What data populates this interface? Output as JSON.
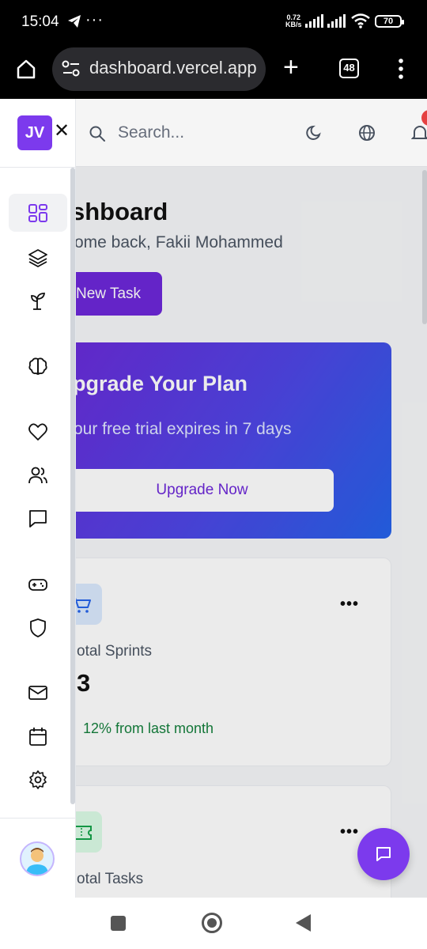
{
  "status_bar": {
    "time": "15:04",
    "net_speed_value": "0.72",
    "net_speed_unit": "KB/s",
    "battery": "70",
    "icons": [
      "telegram-icon",
      "more-dots-icon",
      "signal-icon",
      "signal-icon",
      "wifi-icon",
      "battery-icon"
    ]
  },
  "browser": {
    "url": "dashboard.vercel.app",
    "tab_count": "48"
  },
  "sidebar": {
    "logo": "JV",
    "items": [
      {
        "icon": "dashboard-grid-icon",
        "active": true
      },
      {
        "icon": "layers-icon",
        "active": false
      },
      {
        "icon": "sprout-icon",
        "active": false
      },
      {
        "icon": "brain-icon",
        "active": false
      },
      {
        "icon": "heart-icon",
        "active": false
      },
      {
        "icon": "users-icon",
        "active": false
      },
      {
        "icon": "message-icon",
        "active": false
      },
      {
        "icon": "gamepad-icon",
        "active": false
      },
      {
        "icon": "shield-icon",
        "active": false
      },
      {
        "icon": "mail-icon",
        "active": false
      },
      {
        "icon": "calendar-icon",
        "active": false
      },
      {
        "icon": "settings-icon",
        "active": false
      }
    ]
  },
  "header": {
    "search_placeholder": "Search..."
  },
  "main": {
    "title": "shboard",
    "welcome": "ome back, Fakii Mohammed",
    "new_task_label": "New Task",
    "promo": {
      "title": "pgrade Your Plan",
      "subtitle": "our free trial expires in 7 days",
      "button": "Upgrade Now"
    },
    "cards": [
      {
        "label": "otal Sprints",
        "value": "3",
        "trend": "12% from last month",
        "icon": "cart-icon",
        "more": "•••"
      },
      {
        "label": "otal Tasks",
        "icon": "ticket-icon",
        "more": "•••"
      }
    ]
  },
  "colors": {
    "accent": "#7c3aed",
    "promo_gradient_start": "#6d28d9",
    "promo_gradient_end": "#2563eb",
    "trend_positive": "#15803d"
  }
}
